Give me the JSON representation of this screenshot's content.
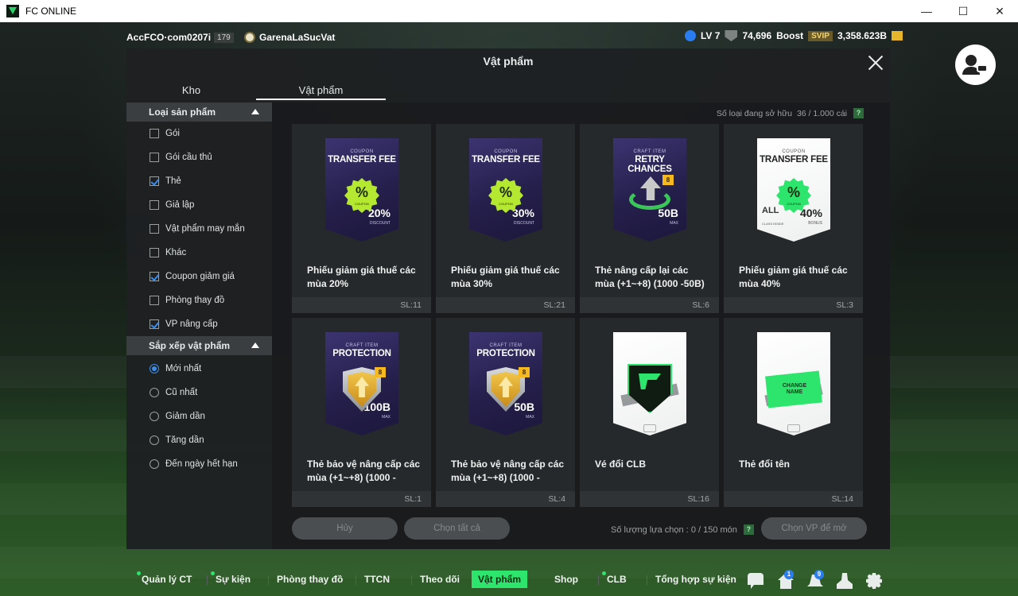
{
  "window": {
    "title": "FC ONLINE",
    "controls": [
      "—",
      "☐",
      "✕"
    ]
  },
  "topbar": {
    "account": "AccFCO·com0207i",
    "account_level": "179",
    "team": "GarenaLaSucVat",
    "level": "LV 7",
    "ovr": "74,696",
    "boost_label": "Boost",
    "svip": "SVIP",
    "coins": "3,358.623B"
  },
  "panel": {
    "title": "Vật phẩm",
    "tabs": [
      {
        "label": "Kho"
      },
      {
        "label": "Vật phẩm"
      }
    ],
    "owned_label": "Số loại đang sở hữu",
    "owned_value": "36 / 1.000 cái",
    "help": "?"
  },
  "sidebar": {
    "category_header": "Loại sản phẩm",
    "categories": [
      {
        "label": "Gói",
        "checked": false
      },
      {
        "label": "Gói cầu thủ",
        "checked": false
      },
      {
        "label": "Thẻ",
        "checked": true
      },
      {
        "label": "Giả lập",
        "checked": false
      },
      {
        "label": "Vật phẩm may mắn",
        "checked": false
      },
      {
        "label": "Khác",
        "checked": false
      },
      {
        "label": "Coupon giảm giá",
        "checked": true
      },
      {
        "label": "Phòng thay đồ",
        "checked": false
      },
      {
        "label": "VP nâng cấp",
        "checked": true
      }
    ],
    "sort_header": "Sắp xếp vật phẩm",
    "sorts": [
      {
        "label": "Mới nhất",
        "selected": true
      },
      {
        "label": "Cũ nhất",
        "selected": false
      },
      {
        "label": "Giảm dần",
        "selected": false
      },
      {
        "label": "Tăng dần",
        "selected": false
      },
      {
        "label": "Đến ngày hết hạn",
        "selected": false
      }
    ]
  },
  "items": [
    {
      "name": "Phiếu giảm giá thuế các mùa 20%",
      "qty": "SL:11",
      "card": {
        "style": "dark",
        "sub": "COUPON",
        "title": "TRANSFER FEE",
        "number": "20%",
        "number_sub": "DISCOUNT",
        "badge": "%",
        "badge_sub": "COUPON"
      }
    },
    {
      "name": "Phiếu giảm giá thuế các mùa 30%",
      "qty": "SL:21",
      "card": {
        "style": "dark",
        "sub": "COUPON",
        "title": "TRANSFER FEE",
        "number": "30%",
        "number_sub": "DISCOUNT",
        "badge": "%",
        "badge_sub": "COUPON"
      }
    },
    {
      "name": "Thẻ nâng cấp lại các mùa (+1~+8) (1000 -50B)",
      "qty": "SL:6",
      "card": {
        "style": "dark",
        "sub": "CRAFT ITEM",
        "title": "RETRY CHANCES",
        "number": "50B",
        "number_sub": "MAX",
        "mini_badge": "8"
      }
    },
    {
      "name": "Phiếu giảm giá thuế các mùa 40%",
      "qty": "SL:3",
      "card": {
        "style": "white",
        "sub": "COUPON",
        "title": "TRANSFER FEE",
        "number": "40%",
        "number_sub": "BONUS",
        "badge": "%",
        "badge_sub": "COUPON",
        "all_text": "ALL",
        "all_sub": "CLASS INSIDE"
      }
    },
    {
      "name": "Thẻ bảo vệ nâng cấp các mùa (+1~+8) (1000 -",
      "qty": "SL:1",
      "card": {
        "style": "dark",
        "sub": "CRAFT ITEM",
        "title": "PROTECTION",
        "number": "100B",
        "number_sub": "MAX",
        "mini_badge": "8"
      }
    },
    {
      "name": "Thẻ bảo vệ nâng cấp các mùa (+1~+8) (1000 -",
      "qty": "SL:4",
      "card": {
        "style": "dark",
        "sub": "CRAFT ITEM",
        "title": "PROTECTION",
        "number": "50B",
        "number_sub": "MAX",
        "mini_badge": "8"
      }
    },
    {
      "name": "Vé đổi CLB",
      "qty": "SL:16",
      "card": {
        "style": "white"
      }
    },
    {
      "name": "Thẻ đổi tên",
      "qty": "SL:14",
      "card": {
        "style": "white",
        "change_name": "CHANGE NAME"
      }
    }
  ],
  "footer": {
    "cancel": "Hủy",
    "select_all": "Chọn tất cả",
    "selection_label": "Số lượng lựa chọn : 0 / 150 món",
    "open": "Chọn VP để mở"
  },
  "bottom_nav": [
    {
      "label": "Quản lý CT",
      "dot": true
    },
    {
      "label": "Sự kiện",
      "dot": true
    },
    {
      "label": "Phòng thay đồ",
      "dot": false
    },
    {
      "label": "TTCN",
      "dot": false
    },
    {
      "label": "Theo dõi",
      "dot": false
    },
    {
      "label": "Vật phẩm",
      "dot": false,
      "active": true
    },
    {
      "label": "Shop",
      "dot": false
    },
    {
      "label": "CLB",
      "dot": true
    },
    {
      "label": "Tổng hợp sự kiện",
      "dot": false
    }
  ],
  "nav_icons": {
    "home_badge": "1",
    "bell_badge": "9"
  },
  "colors": {
    "accent": "#2de56c",
    "panel": "#1e2022",
    "check": "#3b8de8"
  }
}
